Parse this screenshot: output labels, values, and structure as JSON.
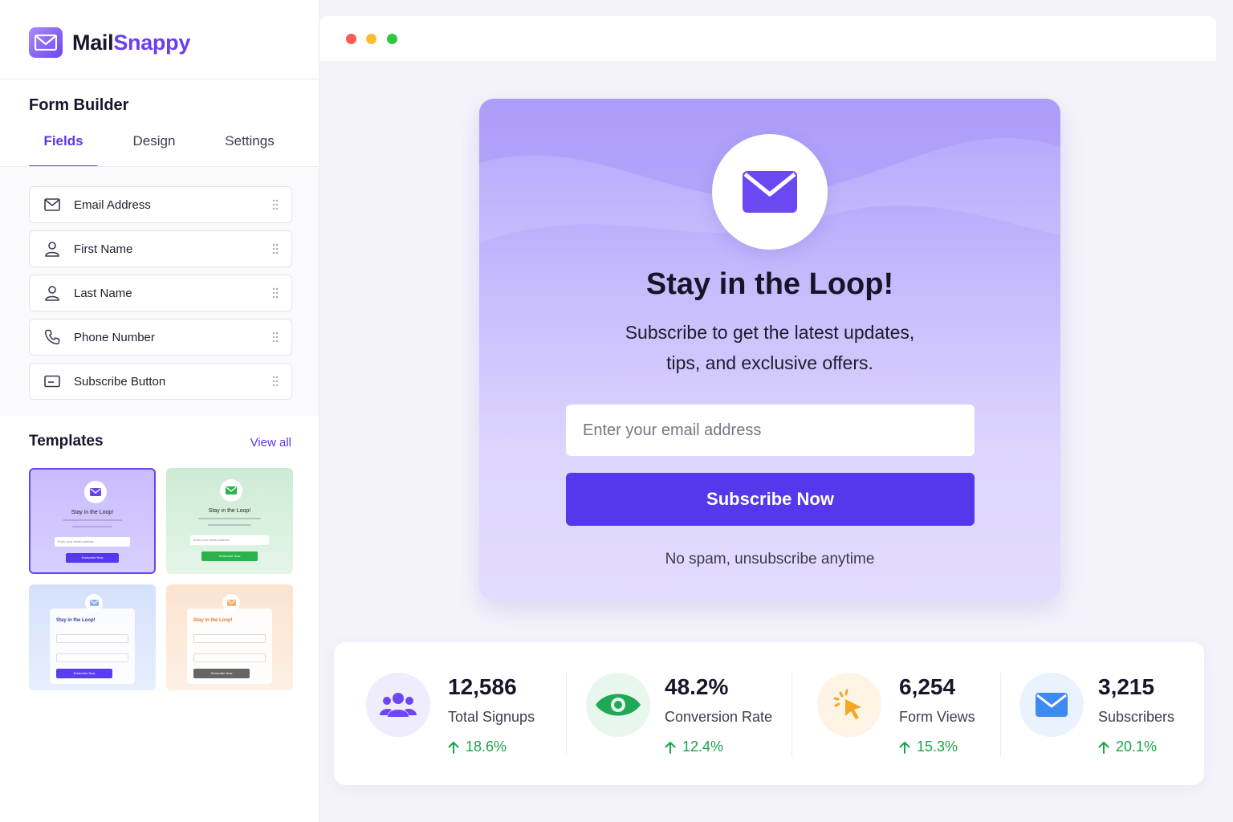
{
  "brand": {
    "name_part1": "Mail",
    "name_part2": "Snappy"
  },
  "sidebar": {
    "title": "Form Builder",
    "tabs": [
      {
        "label": "Fields",
        "active": true
      },
      {
        "label": "Design",
        "active": false
      },
      {
        "label": "Settings",
        "active": false
      }
    ],
    "fields": [
      {
        "label": "Email Address",
        "icon": "mail-icon"
      },
      {
        "label": "First Name",
        "icon": "user-icon"
      },
      {
        "label": "Last Name",
        "icon": "user-icon"
      },
      {
        "label": "Phone Number",
        "icon": "phone-icon"
      },
      {
        "label": "Subscribe Button",
        "icon": "button-icon"
      }
    ],
    "templates_title": "Templates",
    "view_all": "View all",
    "templates": [
      {
        "title": "Stay in the Loop!",
        "input": "Enter your email address",
        "button": "Subscribe Now",
        "accent": "#6a45ef"
      },
      {
        "title": "Stay in the Loop!",
        "input": "Enter your email address",
        "button": "Subscribe Now",
        "accent": "#2bb24c"
      },
      {
        "title": "Stay in the Loop!",
        "button": "Subscribe Now",
        "accent": "#5a3fe8"
      },
      {
        "title": "Stay in the Loop!",
        "button": "Subscribe Now",
        "accent": "#e07a32"
      }
    ]
  },
  "preview": {
    "title": "Stay in the Loop!",
    "subtitle_line1": "Subscribe to get the latest updates,",
    "subtitle_line2": "tips, and exclusive offers.",
    "email_placeholder": "Enter your email address",
    "button": "Subscribe Now",
    "note": "No spam, unsubscribe anytime"
  },
  "stats": [
    {
      "value": "12,586",
      "label": "Total Signups",
      "change": "18.6%",
      "icon": "users-icon",
      "color": "#6d46ef",
      "bg": "#efecfd"
    },
    {
      "value": "48.2%",
      "label": "Conversion Rate",
      "change": "12.4%",
      "icon": "eye-icon",
      "color": "#1fa955",
      "bg": "#e8f7ee"
    },
    {
      "value": "6,254",
      "label": "Form Views",
      "change": "15.3%",
      "icon": "cursor-click-icon",
      "color": "#f5a623",
      "bg": "#fef4e6"
    },
    {
      "value": "3,215",
      "label": "Subscribers",
      "change": "20.1%",
      "icon": "mail-icon",
      "color": "#3d8bf0",
      "bg": "#eaf2fd"
    }
  ],
  "colors": {
    "accent": "#5b34ea",
    "positive": "#1aa34a"
  }
}
